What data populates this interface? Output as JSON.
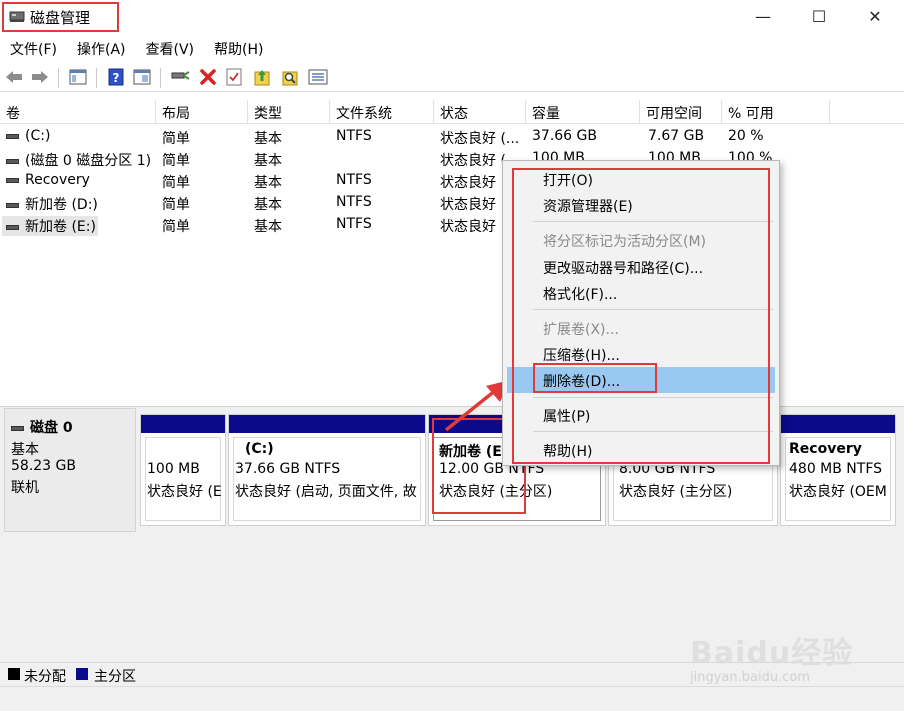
{
  "window": {
    "title": "磁盘管理",
    "minimize_glyph": "—",
    "maximize_glyph": "☐",
    "close_glyph": "✕"
  },
  "menubar": [
    "文件(F)",
    "操作(A)",
    "查看(V)",
    "帮助(H)"
  ],
  "toolbar": {
    "icons": [
      "back-arrow-icon",
      "forward-arrow-icon",
      "console-tree-icon",
      "help-icon",
      "properties-icon",
      "connect-icon",
      "delete-icon",
      "check-icon",
      "upload-icon",
      "search-icon",
      "list-icon"
    ],
    "delete_color": "#d82020"
  },
  "volume_table": {
    "columns": [
      "卷",
      "布局",
      "类型",
      "文件系统",
      "状态",
      "容量",
      "可用空间",
      "% 可用"
    ],
    "rows": [
      {
        "name": "(C:)",
        "layout": "简单",
        "type": "基本",
        "fs": "NTFS",
        "status": "状态良好 (...",
        "capacity": "37.66 GB",
        "free": "7.67 GB",
        "pct": "20 %"
      },
      {
        "name": "(磁盘 0 磁盘分区 1)",
        "layout": "简单",
        "type": "基本",
        "fs": "",
        "status": "状态良好 (...",
        "capacity": "100 MB",
        "free": "100 MB",
        "pct": "100 %"
      },
      {
        "name": "Recovery",
        "layout": "简单",
        "type": "基本",
        "fs": "NTFS",
        "status": "状态良好",
        "capacity": "",
        "free": "",
        "pct": ""
      },
      {
        "name": "新加卷 (D:)",
        "layout": "简单",
        "type": "基本",
        "fs": "NTFS",
        "status": "状态良好",
        "capacity": "",
        "free": "",
        "pct": ""
      },
      {
        "name": "新加卷 (E:)",
        "layout": "简单",
        "type": "基本",
        "fs": "NTFS",
        "status": "状态良好",
        "capacity": "",
        "free": "",
        "pct": ""
      }
    ]
  },
  "disk": {
    "name": "磁盘 0",
    "type": "基本",
    "size": "58.23 GB",
    "state": "联机",
    "partitions": [
      {
        "title": "",
        "size": "100 MB",
        "status": "状态良好 (E"
      },
      {
        "title": "(C:)",
        "size": "37.66 GB NTFS",
        "status": "状态良好 (启动, 页面文件, 故"
      },
      {
        "title": "新加卷 (E",
        "size": "12.00 GB NTFS",
        "status": "状态良好 (主分区)"
      },
      {
        "title": "",
        "size": "8.00 GB NTFS",
        "status": "状态良好 (主分区)"
      },
      {
        "title": "Recovery",
        "size": "480 MB NTFS",
        "status": "状态良好 (OEM"
      }
    ]
  },
  "legend": [
    {
      "label": "未分配",
      "color": "#000000"
    },
    {
      "label": "主分区",
      "color": "#0a0a8a"
    }
  ],
  "context_menu": {
    "items": [
      {
        "label": "打开(O)",
        "enabled": true
      },
      {
        "label": "资源管理器(E)",
        "enabled": true
      },
      {
        "label": "将分区标记为活动分区(M)",
        "enabled": false
      },
      {
        "label": "更改驱动器号和路径(C)...",
        "enabled": true
      },
      {
        "label": "格式化(F)...",
        "enabled": true
      },
      {
        "label": "扩展卷(X)...",
        "enabled": false
      },
      {
        "label": "压缩卷(H)...",
        "enabled": true
      },
      {
        "label": "删除卷(D)...",
        "enabled": true,
        "highlighted": true
      },
      {
        "label": "属性(P)",
        "enabled": true
      },
      {
        "label": "帮助(H)",
        "enabled": true
      }
    ]
  },
  "annotation_color": "#e03a3a",
  "watermark": {
    "brand": "Baidu经验",
    "url": "jingyan.baidu.com"
  }
}
